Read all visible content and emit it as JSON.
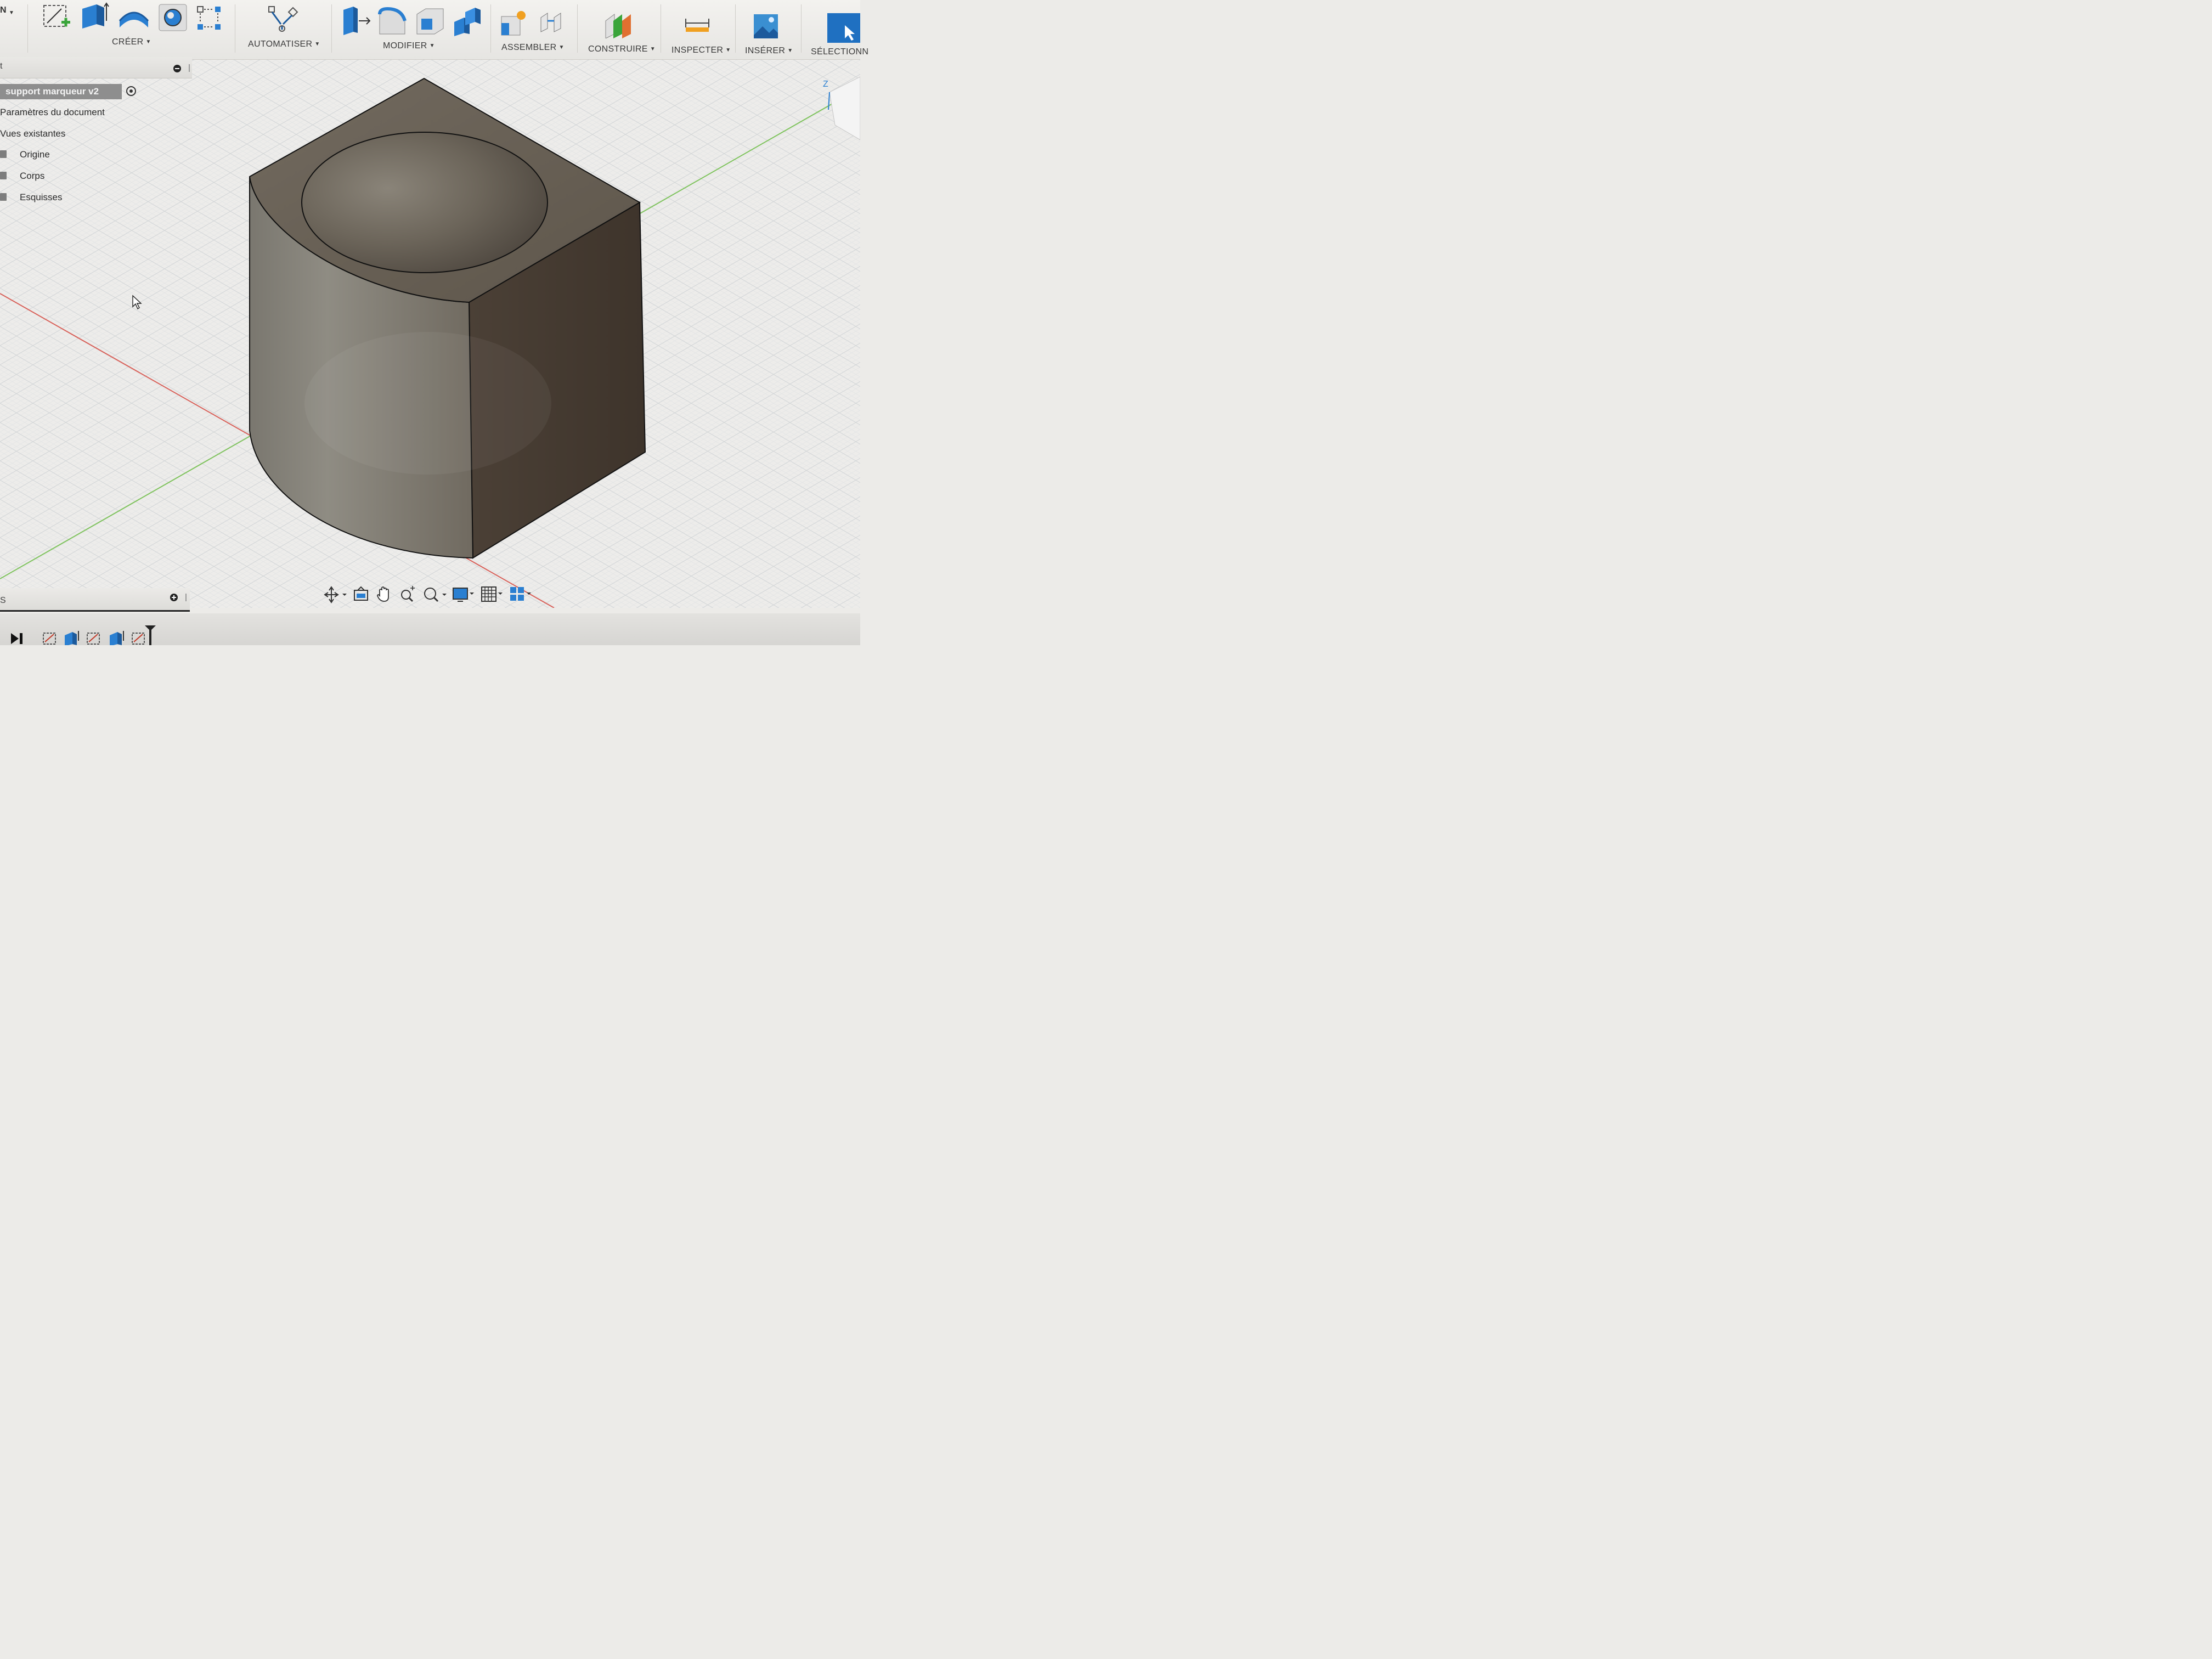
{
  "toolbar": {
    "workspace_switch": "N",
    "groups": [
      {
        "label": "CRÉER"
      },
      {
        "label": "AUTOMATISER"
      },
      {
        "label": "MODIFIER"
      },
      {
        "label": "ASSEMBLER"
      },
      {
        "label": "CONSTRUIRE"
      },
      {
        "label": "INSPECTER"
      },
      {
        "label": "INSÉRER"
      },
      {
        "label": "SÉLECTIONN"
      }
    ],
    "icons": {
      "create": [
        "create-sketch-icon",
        "extrude-icon",
        "revolve-icon",
        "hole-icon",
        "rectangular-pattern-icon"
      ],
      "automate": [
        "automate-icon"
      ],
      "modify": [
        "press-pull-icon",
        "fillet-icon",
        "shell-icon",
        "combine-icon"
      ],
      "assemble": [
        "new-component-icon",
        "joint-icon"
      ],
      "construct": [
        "offset-plane-icon"
      ],
      "inspect": [
        "measure-icon"
      ],
      "insert": [
        "insert-image-icon"
      ],
      "select": [
        "select-icon"
      ]
    }
  },
  "browser": {
    "title": "t",
    "document_name": "support marqueur v2",
    "items": [
      {
        "label": "Paramètres du document"
      },
      {
        "label": "Vues existantes"
      },
      {
        "label": "Origine"
      },
      {
        "label": "Corps"
      },
      {
        "label": "Esquisses"
      }
    ]
  },
  "viewcube": {
    "axis_label": "Z"
  },
  "navbar": {
    "icons": [
      "orbit-icon",
      "look-at-icon",
      "pan-icon",
      "zoom-icon",
      "fit-icon",
      "display-settings-icon",
      "grid-settings-icon",
      "viewports-icon"
    ]
  },
  "comments": {
    "label": "S"
  },
  "timeline": {
    "icons": [
      "play-end-icon",
      "sketch-feature-icon",
      "extrude-feature-icon",
      "sketch-feature-icon",
      "extrude-feature-icon",
      "sketch-feature-icon",
      "timeline-marker-icon"
    ]
  },
  "colors": {
    "model_face_top": "#6b6257",
    "model_face_right": "#43392f",
    "model_face_curved": "#8a867c",
    "grid_line": "#cfd2d4",
    "x_axis": "#d8615a",
    "y_axis": "#7fc35e",
    "accent_blue": "#2a7fd1"
  }
}
